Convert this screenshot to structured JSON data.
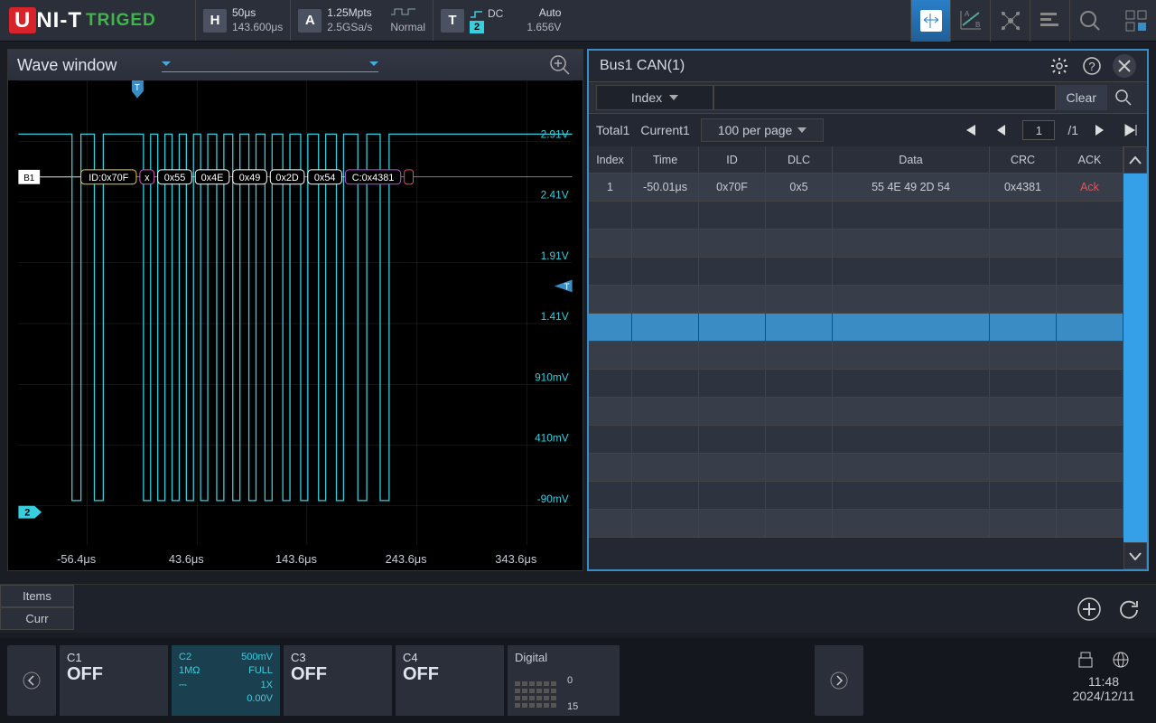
{
  "logo": {
    "brand": "UNI-T",
    "status": "TRIGED"
  },
  "topbar": {
    "h_badge": "H",
    "h_time": "50μs",
    "h_pos": "143.600μs",
    "a_badge": "A",
    "a_pts": "1.25Mpts",
    "a_rate": "2.5GSa/s",
    "a_mode": "Normal",
    "t_badge": "T",
    "t_coupling": "DC",
    "t_mode": "Auto",
    "t_ch": "2",
    "t_level": "1.656V"
  },
  "wave": {
    "title": "Wave window",
    "ylabels": [
      "2.91V",
      "2.41V",
      "1.91V",
      "1.41V",
      "910mV",
      "410mV",
      "-90mV"
    ],
    "xlabels": [
      "-56.4μs",
      "43.6μs",
      "143.6μs",
      "243.6μs",
      "343.6μs"
    ],
    "bus": "B1",
    "ch": "2",
    "trig": "T",
    "decode": {
      "id_label": "ID:0x70F",
      "x": "x",
      "data": [
        "0x55",
        "0x4E",
        "0x49",
        "0x2D",
        "0x54"
      ],
      "crc": "C:0x4381"
    }
  },
  "decoder": {
    "title": "Bus1 CAN(1)",
    "filter_field": "Index",
    "clear": "Clear",
    "total": "Total1",
    "current": "Current1",
    "perpage": "100 per page",
    "page": "1",
    "pages": "/1",
    "cols": [
      "Index",
      "Time",
      "ID",
      "DLC",
      "Data",
      "CRC",
      "ACK"
    ],
    "rows": [
      {
        "idx": "1",
        "time": "-50.01μs",
        "id": "0x70F",
        "dlc": "0x5",
        "data": "55 4E 49 2D 54",
        "crc": "0x4381",
        "ack": "Ack"
      }
    ]
  },
  "measure": {
    "tab1": "Items",
    "tab2": "Curr"
  },
  "channels": {
    "c1": {
      "name": "C1",
      "state": "OFF"
    },
    "c2": {
      "name": "C2",
      "scale": "500mV",
      "imp": "1MΩ",
      "bw": "FULL",
      "probe": "1X",
      "offset": "0.00V"
    },
    "c3": {
      "name": "C3",
      "state": "OFF"
    },
    "c4": {
      "name": "C4",
      "state": "OFF"
    },
    "digital": {
      "name": "Digital",
      "hi": "0",
      "lo": "15"
    }
  },
  "clock": {
    "time": "11:48",
    "date": "2024/12/11"
  }
}
